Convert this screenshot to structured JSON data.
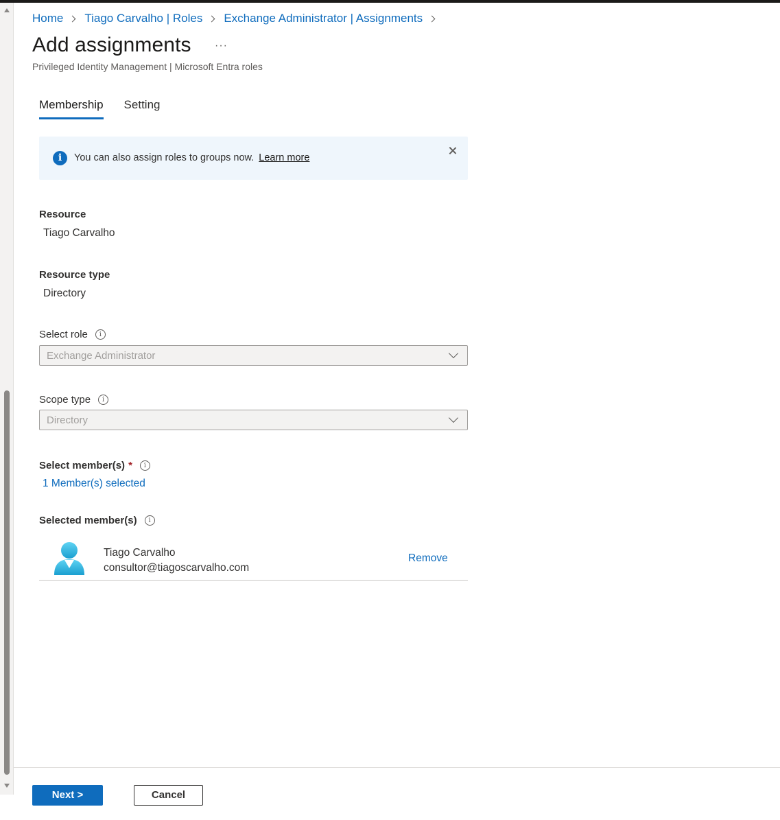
{
  "breadcrumb": [
    "Home",
    "Tiago Carvalho | Roles",
    "Exchange Administrator | Assignments"
  ],
  "page": {
    "title": "Add assignments",
    "more": "···",
    "subtitle": "Privileged Identity Management | Microsoft Entra roles"
  },
  "tabs": [
    {
      "label": "Membership",
      "active": true
    },
    {
      "label": "Setting",
      "active": false
    }
  ],
  "info_banner": {
    "text": "You can also assign roles to groups now.",
    "link": "Learn more"
  },
  "resource": {
    "label": "Resource",
    "value": "Tiago Carvalho"
  },
  "resource_type": {
    "label": "Resource type",
    "value": "Directory"
  },
  "select_role": {
    "label": "Select role",
    "value": "Exchange Administrator"
  },
  "scope_type": {
    "label": "Scope type",
    "value": "Directory"
  },
  "select_members": {
    "label": "Select member(s)",
    "required_mark": "*",
    "link": "1 Member(s) selected"
  },
  "selected_members": {
    "label": "Selected member(s)",
    "items": [
      {
        "name": "Tiago Carvalho",
        "email": "consultor@tiagoscarvalho.com",
        "action": "Remove"
      }
    ]
  },
  "footer": {
    "next": "Next >",
    "cancel": "Cancel"
  },
  "colors": {
    "accent": "#0f6cbd",
    "banner_bg": "#eff6fc",
    "avatar": "#2bb5e0"
  },
  "icons": [
    "info-icon",
    "close-icon",
    "tooltip-icon",
    "chevron-down-icon",
    "chevron-right-icon",
    "user-avatar-icon",
    "more-icon"
  ]
}
